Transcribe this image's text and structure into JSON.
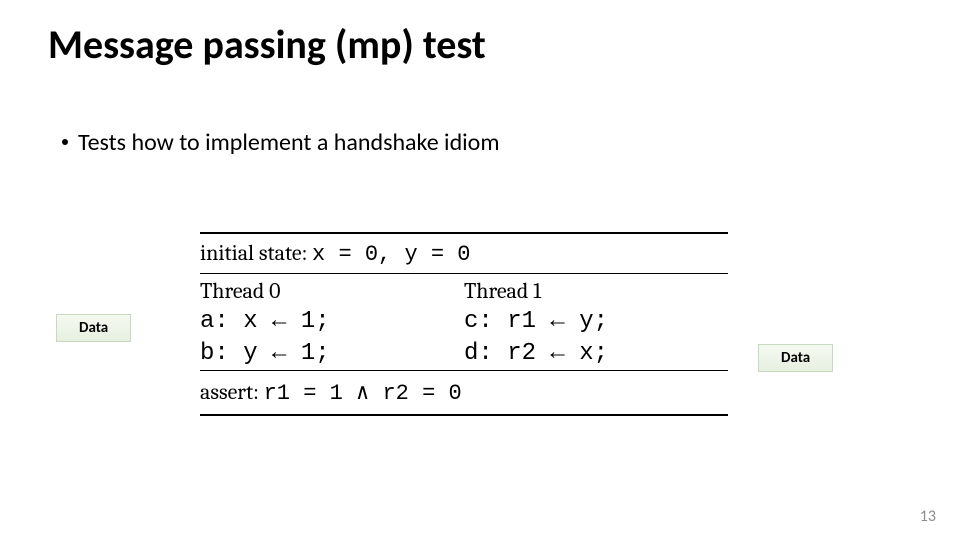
{
  "title": "Message passing (mp) test",
  "bullet": "Tests how to implement a handshake idiom",
  "initial_state_prefix": "initial state: ",
  "initial_state_expr": "x = 0, y = 0",
  "thread0": {
    "head": "Thread 0",
    "lines": [
      {
        "label": "a",
        "text": "a: x ← 1;",
        "highlight": true
      },
      {
        "label": "b",
        "text": "b: y ← 1;",
        "highlight": false
      }
    ]
  },
  "thread1": {
    "head": "Thread 1",
    "lines": [
      {
        "label": "c",
        "text": "c: r1 ← y;",
        "highlight": false
      },
      {
        "label": "d",
        "text": "d: r2 ← x;",
        "highlight": true
      }
    ]
  },
  "assert_prefix": "assert: ",
  "assert_expr": "r1 = 1 ∧ r2 = 0",
  "label_data_left": "Data",
  "label_data_right": "Data",
  "page_number": "13",
  "chart_data": {
    "type": "table",
    "title": "Message passing (mp) litmus test",
    "initial_state": {
      "x": 0,
      "y": 0
    },
    "threads": [
      {
        "name": "Thread 0",
        "instructions": [
          {
            "label": "a",
            "op": "write",
            "lhs": "x",
            "rhs": 1,
            "tag": "Data"
          },
          {
            "label": "b",
            "op": "write",
            "lhs": "y",
            "rhs": 1
          }
        ]
      },
      {
        "name": "Thread 1",
        "instructions": [
          {
            "label": "c",
            "op": "read",
            "lhs": "r1",
            "rhs": "y"
          },
          {
            "label": "d",
            "op": "read",
            "lhs": "r2",
            "rhs": "x",
            "tag": "Data"
          }
        ]
      }
    ],
    "assert": "r1 = 1 ∧ r2 = 0"
  }
}
